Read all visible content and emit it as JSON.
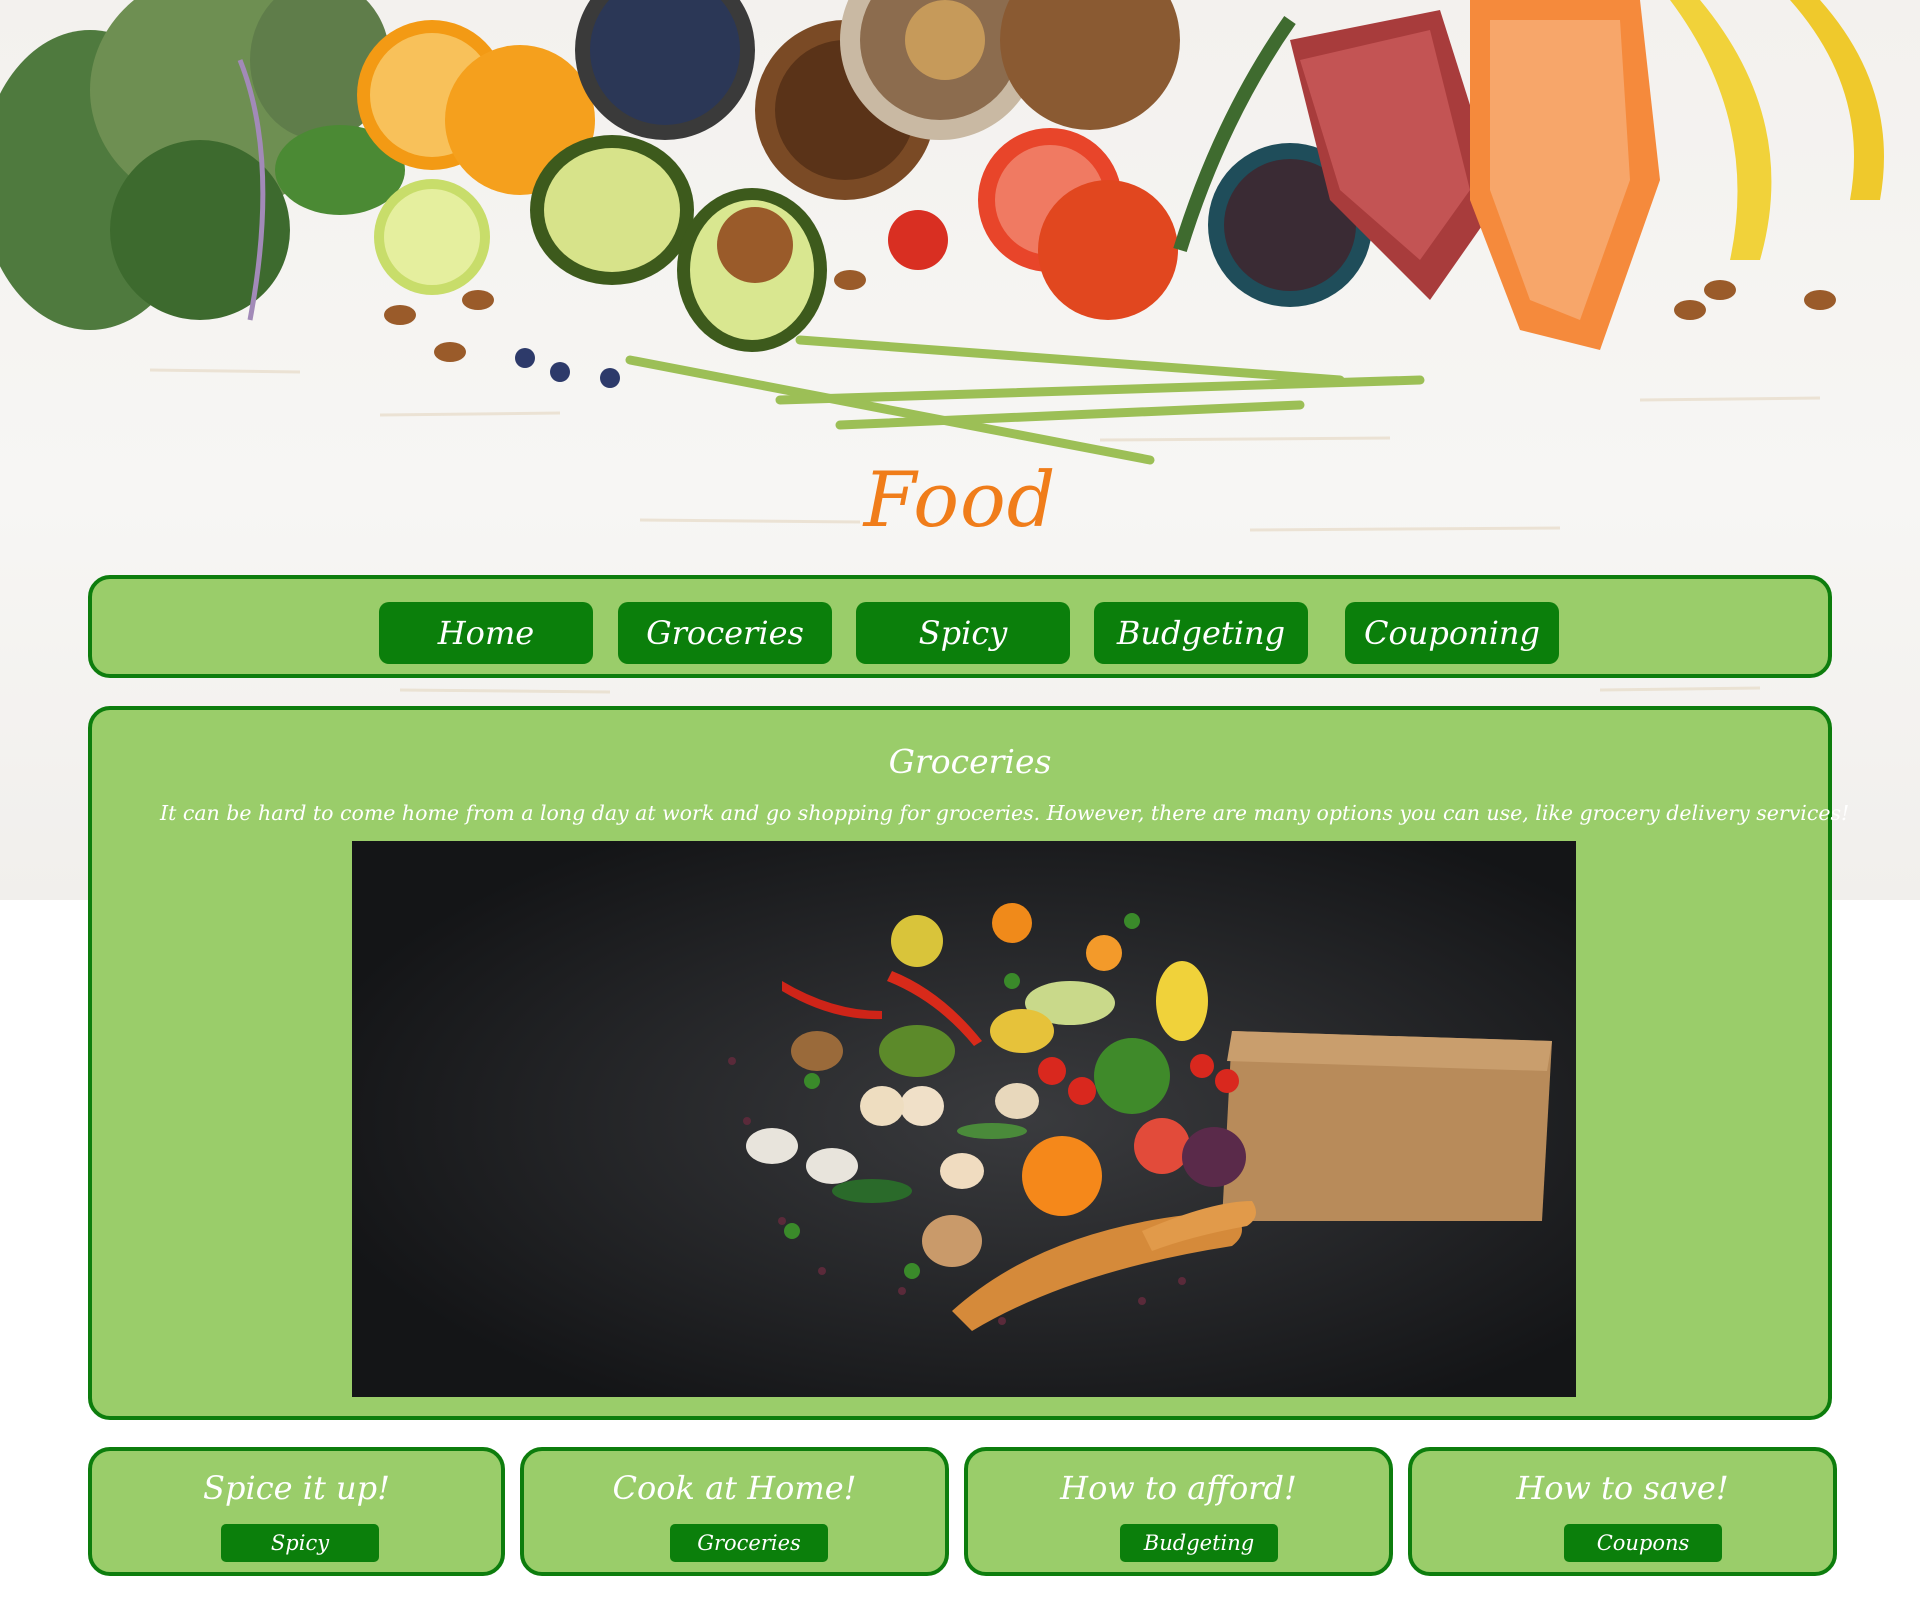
{
  "site": {
    "title": "Food"
  },
  "nav": {
    "items": [
      {
        "label": "Home"
      },
      {
        "label": "Groceries"
      },
      {
        "label": "Spicy"
      },
      {
        "label": "Budgeting"
      },
      {
        "label": "Couponing"
      }
    ]
  },
  "main": {
    "heading": "Groceries",
    "text": "It can be hard to come home from a long day at work and go shopping for groceries. However, there are many options you can use, like grocery delivery services!"
  },
  "cards": [
    {
      "title": "Spice it up!",
      "button": "Spicy"
    },
    {
      "title": "Cook at Home!",
      "button": "Groceries"
    },
    {
      "title": "How to afford!",
      "button": "Budgeting"
    },
    {
      "title": "How to save!",
      "button": "Coupons"
    }
  ],
  "colors": {
    "title": "#f07d1a",
    "panel": "#9acd6a",
    "border": "#0d7d0d",
    "button": "#0b7f0b"
  }
}
